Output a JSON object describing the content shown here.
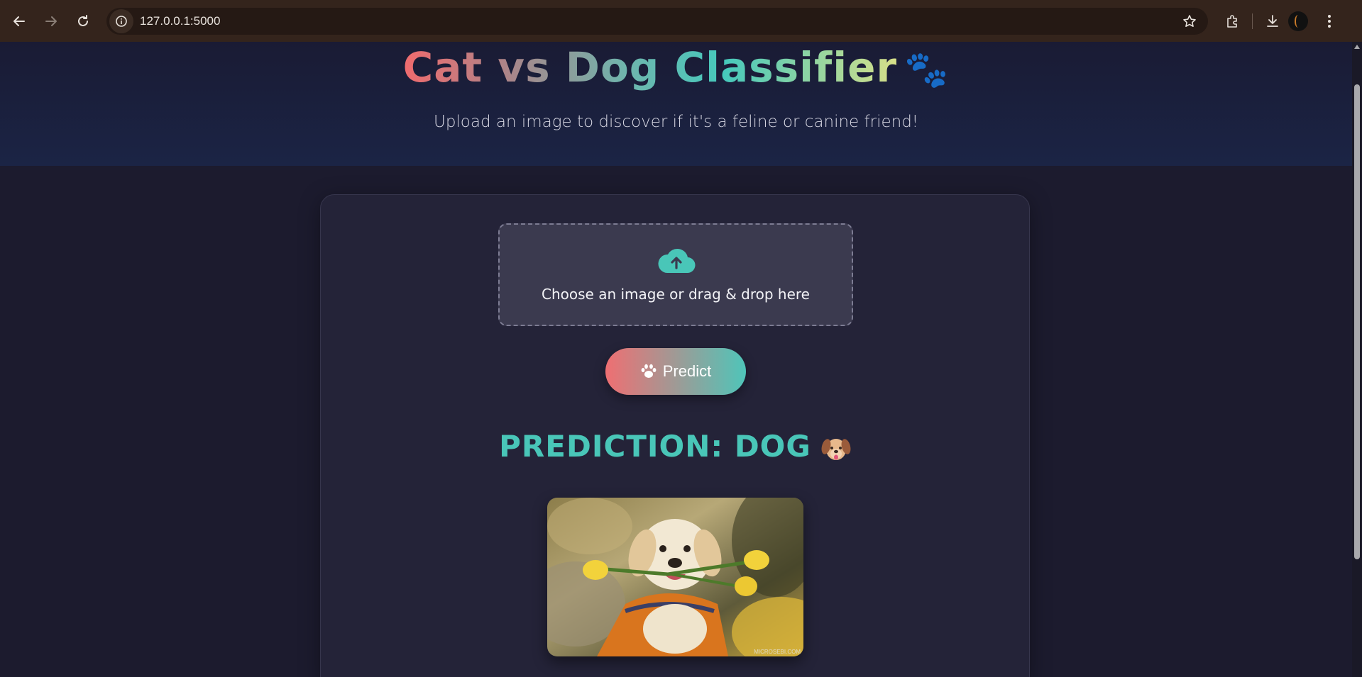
{
  "browser": {
    "url": "127.0.0.1:5000",
    "icons": [
      "back-icon",
      "forward-icon",
      "reload-icon",
      "site-info-icon",
      "bookmark-star-icon",
      "extensions-icon",
      "downloads-icon",
      "profile-avatar",
      "menu-icon"
    ]
  },
  "hero": {
    "title": "Cat vs Dog Classifier",
    "title_emoji": "🐾",
    "subtitle": "Upload an image to discover if it's a feline or canine friend!"
  },
  "upload": {
    "label": "Choose an image or drag & drop here",
    "icon": "cloud-upload-icon"
  },
  "predict_button": {
    "label": "Predict",
    "icon": "paw-icon"
  },
  "result": {
    "text": "PREDICTION: DOG",
    "emoji": "dog-face-emoji",
    "image_watermark": "MICROSEBI.COM"
  },
  "colors": {
    "accent_teal": "#49c6b8",
    "accent_coral": "#ef6f72",
    "background": "#1c1b2e",
    "card": "#242338"
  }
}
